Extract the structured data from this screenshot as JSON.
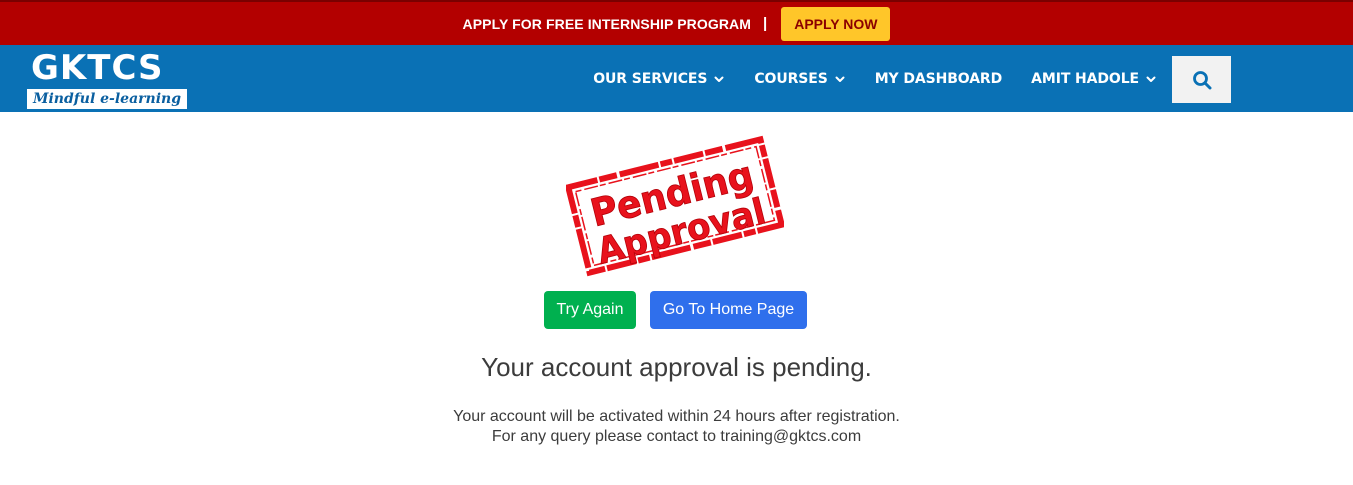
{
  "banner": {
    "text": "APPLY FOR FREE INTERNSHIP PROGRAM",
    "separator": "|",
    "apply_label": "APPLY NOW"
  },
  "brand": {
    "name": "GKTCS",
    "tagline": "Mindful e-learning"
  },
  "nav": {
    "items": [
      {
        "label": "OUR SERVICES",
        "icon": "chevron-down-icon"
      },
      {
        "label": "COURSES",
        "icon": "chevron-down-icon"
      },
      {
        "label": "MY DASHBOARD"
      },
      {
        "label": "AMIT HADOLE",
        "icon": "chevron-down-icon"
      }
    ],
    "search_icon": "search-icon"
  },
  "stamp": {
    "line1": "Pending",
    "line2": "Approval",
    "color": "#e8121c"
  },
  "buttons": {
    "try_again": "Try Again",
    "home": "Go To Home Page"
  },
  "message": {
    "heading": "Your account approval is pending.",
    "line1": "Your account will be activated within 24 hours after registration.",
    "line2": "For any query please contact to training@gktcs.com"
  },
  "colors": {
    "banner_bg": "#b30000",
    "nav_bg": "#0a71b5",
    "apply_bg": "#ffc629",
    "try_again_bg": "#00b04f",
    "home_bg": "#2f6fec"
  }
}
